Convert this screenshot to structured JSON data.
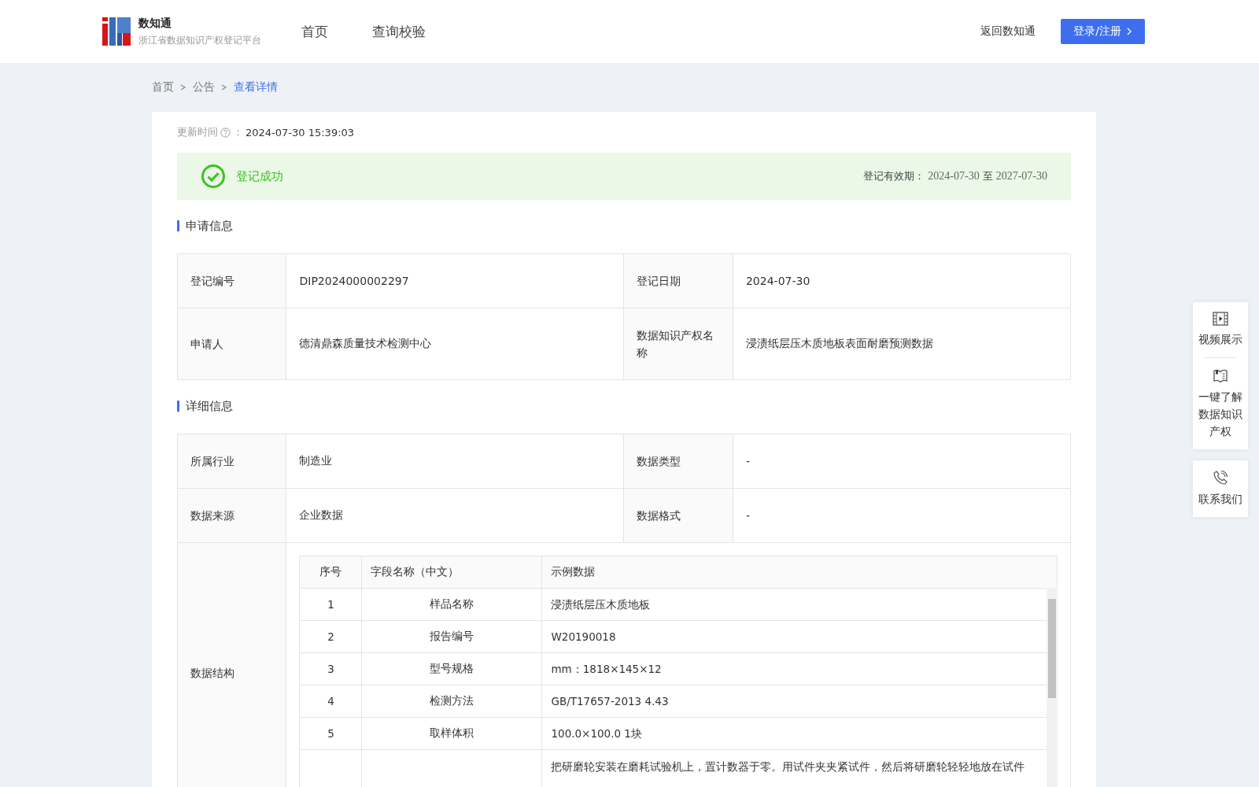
{
  "header": {
    "brand": "数知通",
    "subtitle": "浙江省数据知识产权登记平台",
    "nav": [
      {
        "label": "首页",
        "selected": false
      },
      {
        "label": "查询校验",
        "selected": false
      }
    ],
    "back_link": "返回数知通",
    "login_button": "登录/注册"
  },
  "breadcrumb": [
    {
      "label": "首页",
      "selected": false
    },
    {
      "label": "公告",
      "selected": false
    },
    {
      "label": "查看详情",
      "selected": true
    }
  ],
  "update": {
    "label": "更新时间",
    "colon": "：",
    "value": "2024-07-30 15:39:03"
  },
  "status": {
    "text": "登记成功",
    "validity_label": "登记有效期：",
    "validity_from": "2024-07-30",
    "validity_to_word": "至",
    "validity_to": "2027-07-30"
  },
  "application": {
    "title": "申请信息",
    "rows": [
      [
        {
          "label": "登记编号",
          "value": "DIP2024000002297"
        },
        {
          "label": "登记日期",
          "value": "2024-07-30"
        }
      ],
      [
        {
          "label": "申请人",
          "value": "德清鼎森质量技术检测中心"
        },
        {
          "label": "数据知识产权名称",
          "value": "浸渍纸层压木质地板表面耐磨预测数据"
        }
      ]
    ]
  },
  "details": {
    "title": "详细信息",
    "rows": [
      [
        {
          "label": "所属行业",
          "value": "制造业"
        },
        {
          "label": "数据类型",
          "value": "-"
        }
      ],
      [
        {
          "label": "数据来源",
          "value": "企业数据"
        },
        {
          "label": "数据格式",
          "value": "-"
        }
      ]
    ],
    "structure_label": "数据结构",
    "structure": {
      "columns": [
        "序号",
        "字段名称（中文）",
        "示例数据"
      ],
      "rows": [
        {
          "no": "1",
          "field": "样品名称",
          "example": "浸渍纸层压木质地板"
        },
        {
          "no": "2",
          "field": "报告编号",
          "example": "W20190018"
        },
        {
          "no": "3",
          "field": "型号规格",
          "example": "mm：1818×145×12"
        },
        {
          "no": "4",
          "field": "检测方法",
          "example": "GB/T17657-2013 4.43"
        },
        {
          "no": "5",
          "field": "取样体积",
          "example": "100.0×100.0 1块"
        },
        {
          "example": "把研磨轮安装在磨耗试验机上，置计数器于零。用试件夹夹紧试件，然后将研磨轮轻轻地放在试件"
        }
      ]
    }
  },
  "side_panel": [
    {
      "kind": "video",
      "label": "视频展示"
    },
    {
      "kind": "book",
      "label": "一键了解数据知识产权"
    },
    {
      "kind": "phone",
      "label": "联系我们"
    }
  ]
}
